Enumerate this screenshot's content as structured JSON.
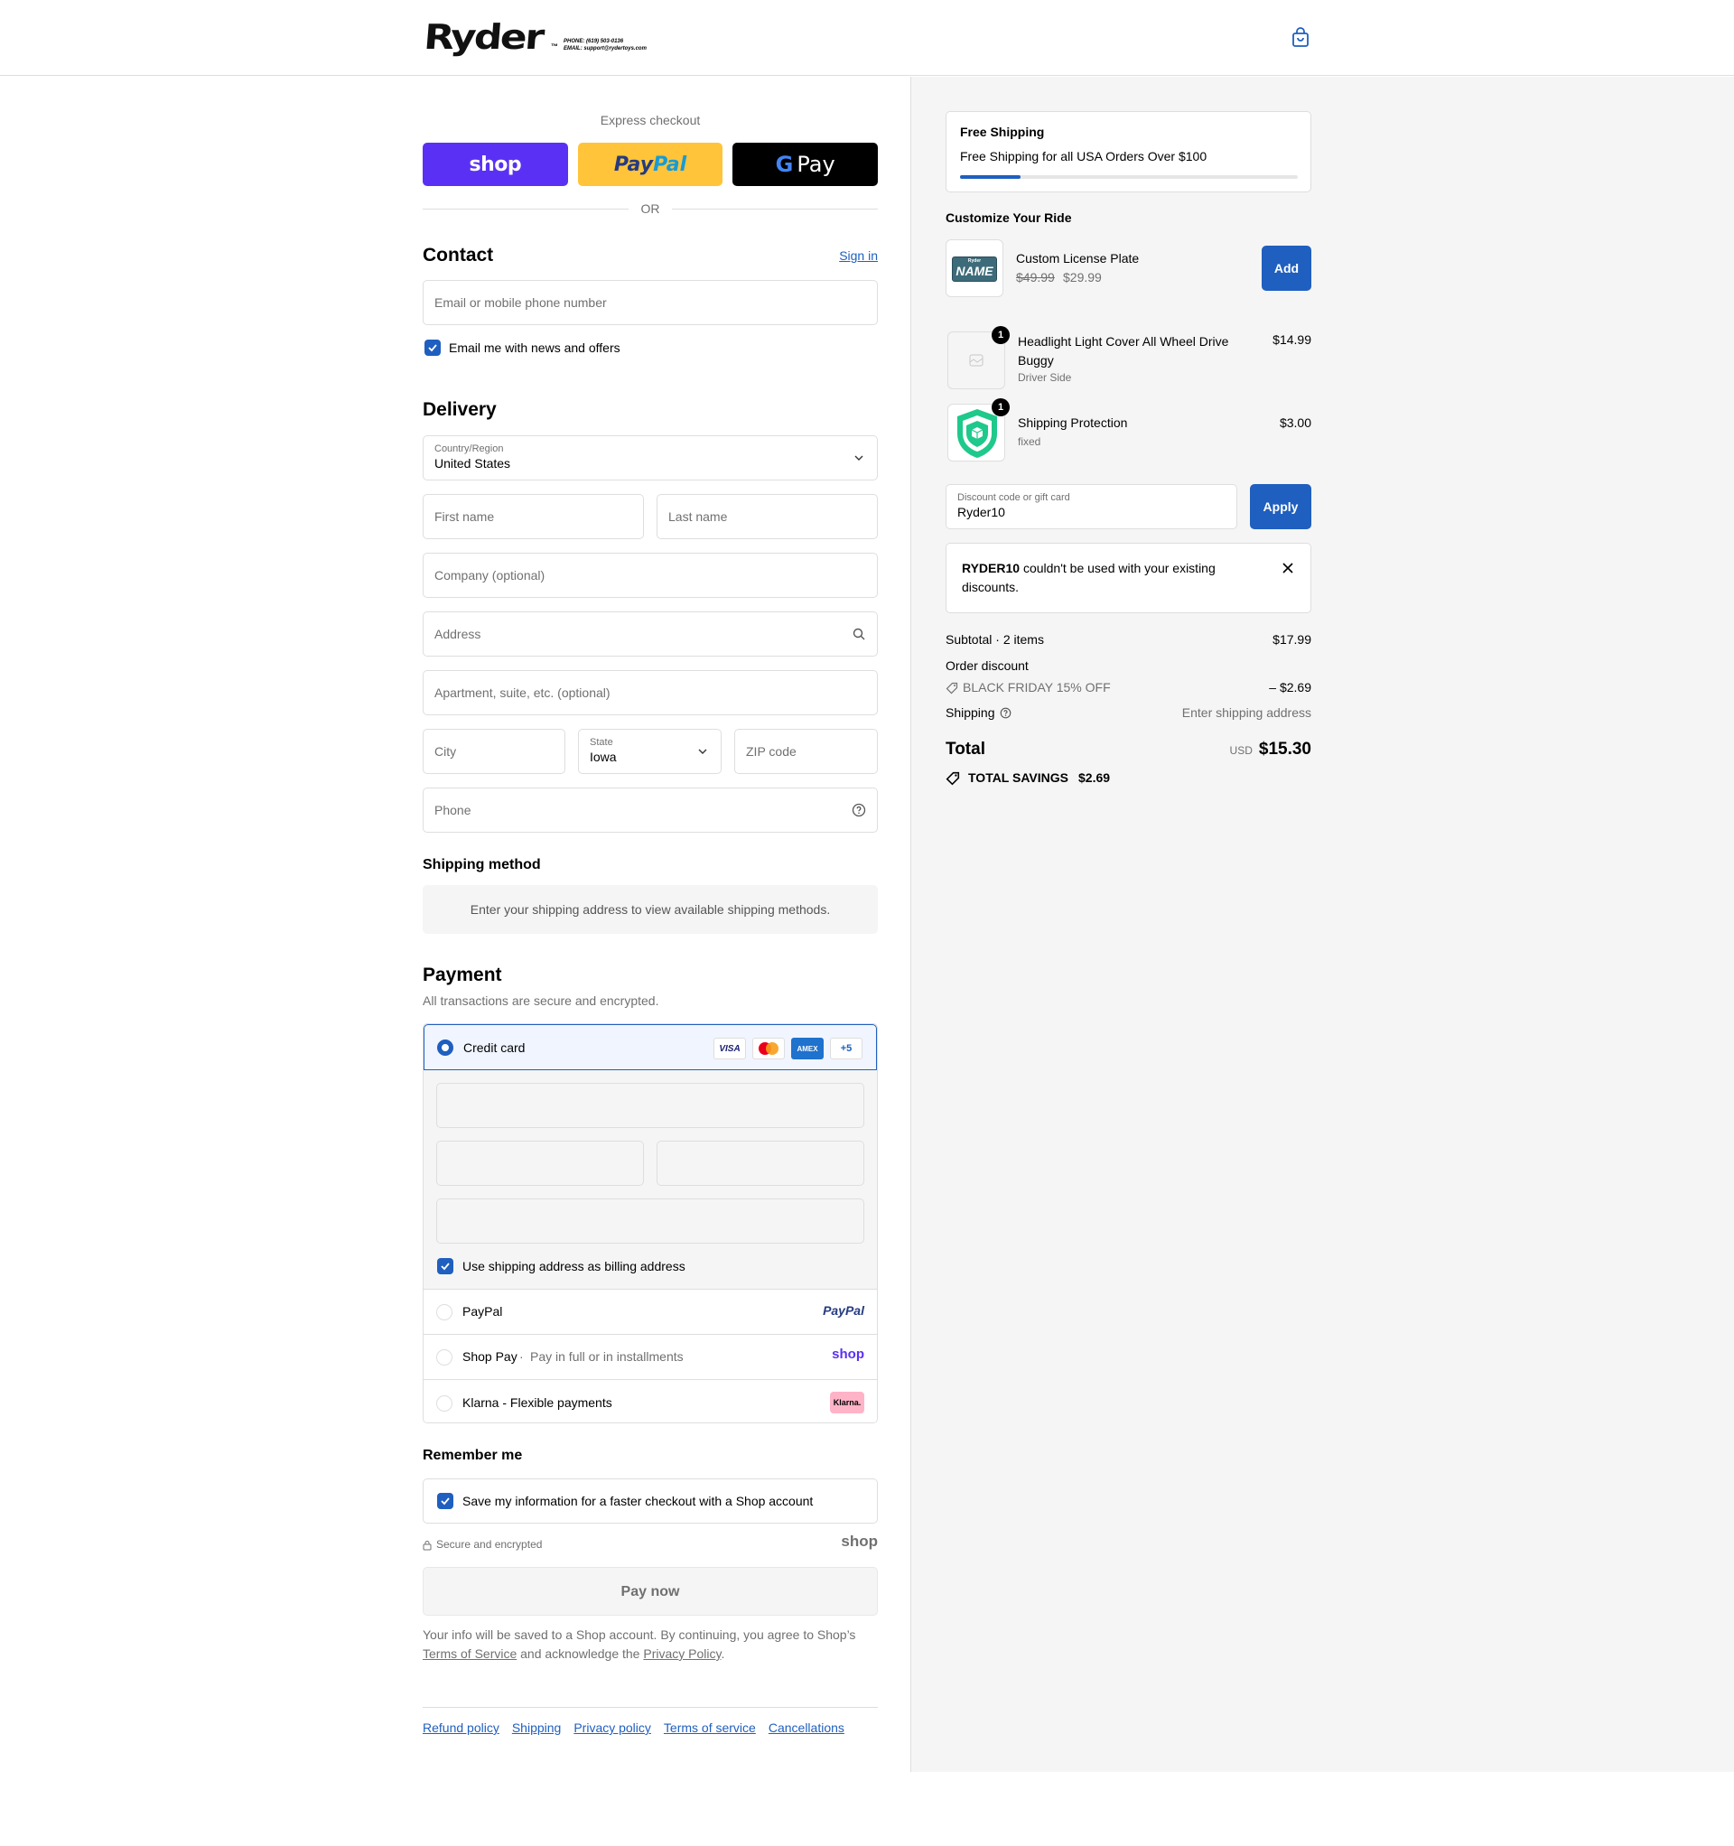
{
  "header": {
    "logo": "Ryder",
    "logo_tm": "™",
    "phone": "PHONE: (619) 503-0136",
    "email": "EMAIL: support@rydertoys.com"
  },
  "express": {
    "title": "Express checkout",
    "shop_label": "shop",
    "paypal_a": "Pay",
    "paypal_b": "Pal",
    "gpay_g": "G",
    "gpay_label": "Pay",
    "or": "OR"
  },
  "contact": {
    "title": "Contact",
    "signin": "Sign in",
    "email_placeholder": "Email or mobile phone number",
    "newsletter": "Email me with news and offers"
  },
  "delivery": {
    "title": "Delivery",
    "country_label": "Country/Region",
    "country": "United States",
    "first_name": "First name",
    "last_name": "Last name",
    "company": "Company (optional)",
    "address": "Address",
    "apartment": "Apartment, suite, etc. (optional)",
    "city": "City",
    "state_label": "State",
    "state": "Iowa",
    "zip": "ZIP code",
    "phone": "Phone"
  },
  "shipping_method": {
    "title": "Shipping method",
    "note": "Enter your shipping address to view available shipping methods."
  },
  "payment": {
    "title": "Payment",
    "subtitle": "All transactions are secure and encrypted.",
    "credit_card": "Credit card",
    "card_visa": "VISA",
    "card_amex": "AMEX",
    "card_more": "+5",
    "billing_same": "Use shipping address as billing address",
    "paypal": "PayPal",
    "paypal_logo": "PayPal",
    "shop_pay": "Shop Pay",
    "shop_pay_sep": "·",
    "shop_pay_desc": "Pay in full or in installments",
    "shop_logo": "shop",
    "klarna": "Klarna - Flexible payments",
    "klarna_logo": "Klarna."
  },
  "remember": {
    "title": "Remember me",
    "save": "Save my information for a faster checkout with a Shop account",
    "secure": "Secure and encrypted",
    "shop_logo": "shop"
  },
  "pay_now": "Pay now",
  "legal": {
    "p1": "Your info will be saved to a Shop account. By continuing, you agree to Shop’s ",
    "tos": "Terms of Service",
    "p2": " and acknowledge the ",
    "privacy": "Privacy Policy",
    "p3": "."
  },
  "footer": {
    "links": [
      "Refund policy",
      "Shipping",
      "Privacy policy",
      "Terms of service",
      "Cancellations"
    ]
  },
  "summary": {
    "free_shipping_title": "Free Shipping",
    "free_shipping_text": "Free Shipping for all USA Orders Over $100",
    "free_shipping_progress": 0.18,
    "upsell_title": "Customize Your Ride",
    "upsell_item": "Custom License Plate",
    "upsell_old_price": "$49.99",
    "upsell_price": "$29.99",
    "upsell_plate_text": "NAME",
    "upsell_plate_top": "Ryder",
    "add": "Add",
    "items": [
      {
        "name": "Headlight Light Cover All Wheel Drive Buggy",
        "variant": "Driver Side",
        "price": "$14.99",
        "qty": "1"
      },
      {
        "name": "Shipping Protection",
        "variant": "fixed",
        "price": "$3.00",
        "qty": "1"
      }
    ],
    "discount_label": "Discount code or gift card",
    "discount_value": "Ryder10",
    "apply": "Apply",
    "error_code": "RYDER10",
    "error_text": " couldn't be used with your existing discounts.",
    "subtotal_label": "Subtotal · 2 items",
    "subtotal": "$17.99",
    "order_discount": "Order discount",
    "discount_name": "BLACK FRIDAY 15% OFF",
    "discount_amount": "– $2.69",
    "shipping_label": "Shipping",
    "shipping_value": "Enter shipping address",
    "total_label": "Total",
    "currency": "USD",
    "total": "$15.30",
    "savings_label": "TOTAL SAVINGS",
    "savings": "$2.69"
  },
  "colors": {
    "accent": "#1f5fbf",
    "shop": "#5a31f4",
    "paypal": "#ffc439",
    "gpay": "#000000",
    "shield": "#1ec98b"
  }
}
